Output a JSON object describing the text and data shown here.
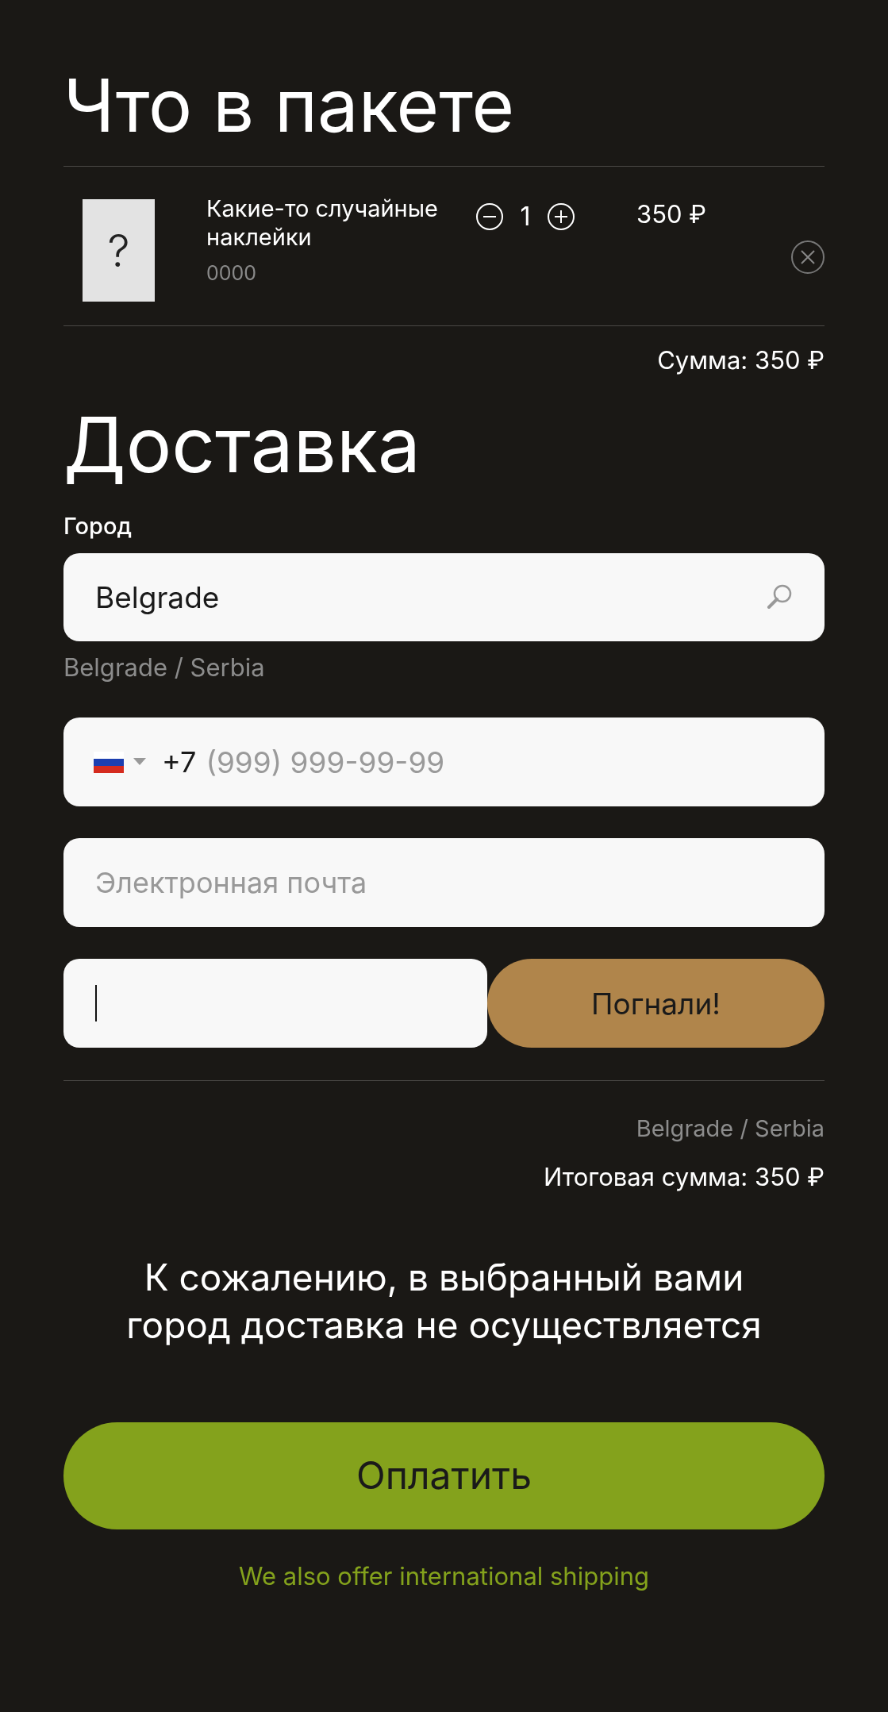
{
  "cart": {
    "title": "Что в пакете",
    "items": [
      {
        "name": "Какие-то случайные наклейки",
        "sku": "0000",
        "image_placeholder": "?",
        "quantity": "1",
        "price": "350 ₽"
      }
    ],
    "sum": "Сумма: 350 ₽"
  },
  "delivery": {
    "title": "Доставка",
    "city_label": "Город",
    "city_value": "Belgrade",
    "city_hint": "Belgrade / Serbia",
    "phone": {
      "prefix": "+7",
      "placeholder": "(999) 999-99-99"
    },
    "email": {
      "placeholder": "Электронная почта"
    },
    "code": {
      "focused": true
    },
    "go_button": "Погнали!"
  },
  "summary": {
    "location": "Belgrade / Serbia",
    "total": "Итоговая сумма: 350 ₽"
  },
  "notice": "К сожалению, в выбранный вами город доставка не осуществляется",
  "pay_button": "Оплатить",
  "international_link": "We also offer international shipping"
}
